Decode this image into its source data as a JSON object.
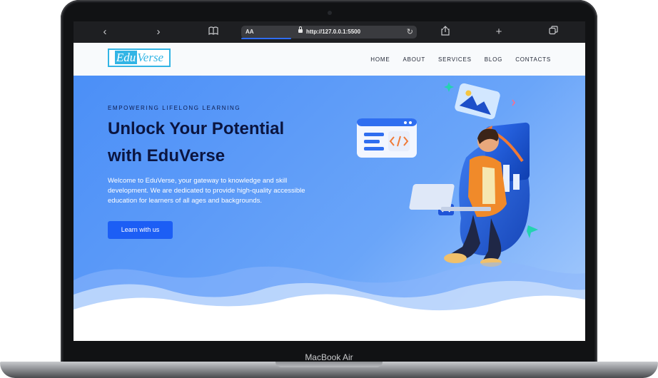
{
  "device": {
    "label": "MacBook Air"
  },
  "browser": {
    "back_icon": "chevron-left-icon",
    "forward_icon": "chevron-right-icon",
    "reader_icon": "book-icon",
    "address_text_size": "AA",
    "url": "http://127.0.0.1:5500",
    "reload_icon": "reload-icon",
    "share_icon": "share-icon",
    "new_tab_icon": "plus-icon",
    "tabs_icon": "tabs-icon"
  },
  "site": {
    "logo": {
      "part1": "Edu",
      "part2": "Verse"
    },
    "nav": [
      "HOME",
      "ABOUT",
      "SERVICES",
      "BLOG",
      "CONTACTS"
    ]
  },
  "hero": {
    "eyebrow": "EMPOWERING LIFELONG LEARNING",
    "headline_line1": "Unlock Your Potential",
    "headline_line2": "with EduVerse",
    "blurb": "Welcome to EduVerse, your gateway to knowledge and skill development. We are dedicated to provide high-quality accessible education for learners of all ages and backgrounds.",
    "cta_label": "Learn with us"
  },
  "colors": {
    "accent": "#1c5ef5",
    "logo": "#33b5e5",
    "hero_gradient_start": "#4b8ff7",
    "hero_gradient_end": "#a9cdfc",
    "headline": "#0b1540"
  }
}
